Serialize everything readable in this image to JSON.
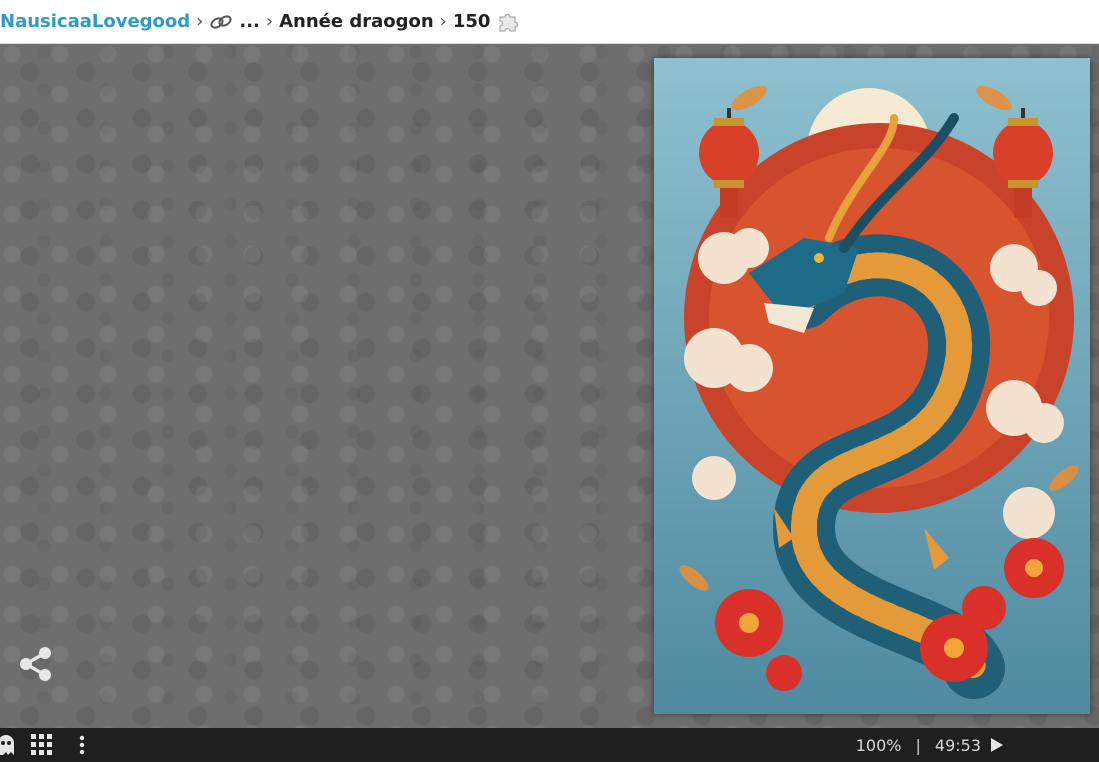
{
  "breadcrumb": {
    "user": "NausicaaLovegood",
    "ellipsis": "...",
    "album": "Année draogon",
    "pieces": "150",
    "link_icon": "link-icon",
    "piece_icon": "puzzle-piece-icon",
    "separator_icon": "chevron-right-icon"
  },
  "board": {
    "share_icon": "share-icon"
  },
  "puzzle": {
    "image_icon": "dragon-artwork"
  },
  "bottombar": {
    "zoom": "100%",
    "separator": "|",
    "timer": "49:53",
    "play_icon": "play-icon",
    "ghost_icon": "ghost-icon",
    "grid_icon": "grid-icon",
    "menu_icon": "vertical-dots-icon"
  },
  "colors": {
    "link_blue": "#2b9dc4",
    "board_gray": "#6e6e6e",
    "bar_dark": "#1f1f1f"
  }
}
